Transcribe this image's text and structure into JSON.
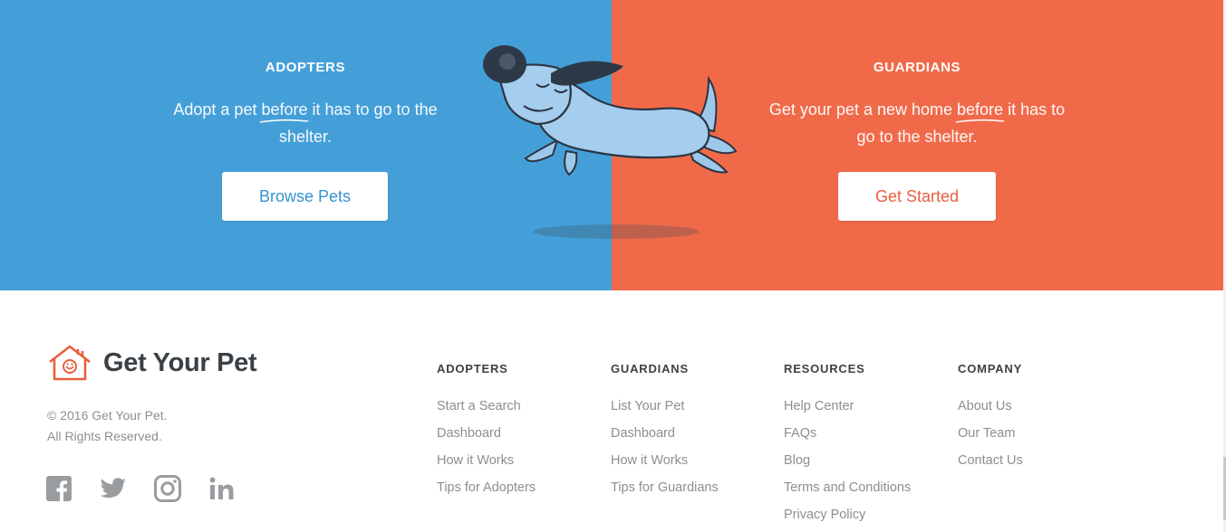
{
  "hero": {
    "adopters": {
      "heading": "ADOPTERS",
      "text_before": "Adopt a pet ",
      "text_emphasis": "before",
      "text_after": " it has to go to the shelter.",
      "button": "Browse Pets"
    },
    "guardians": {
      "heading": "GUARDIANS",
      "text_before": "Get your pet a new home ",
      "text_emphasis": "before",
      "text_after": " it has to go to the shelter.",
      "button": "Get Started"
    },
    "colors": {
      "blue": "#449fd8",
      "orange": "#f06a4a"
    }
  },
  "footer": {
    "brand": "Get Your Pet",
    "copyright_line1": "© 2016 Get Your Pet.",
    "copyright_line2": "All Rights Reserved.",
    "social": [
      "facebook-icon",
      "twitter-icon",
      "instagram-icon",
      "linkedin-icon"
    ],
    "columns": [
      {
        "title": "ADOPTERS",
        "links": [
          "Start a Search",
          "Dashboard",
          "How it Works",
          "Tips for Adopters"
        ]
      },
      {
        "title": "GUARDIANS",
        "links": [
          "List Your Pet",
          "Dashboard",
          "How it Works",
          "Tips for Guardians"
        ]
      },
      {
        "title": "RESOURCES",
        "links": [
          "Help Center",
          "FAQs",
          "Blog",
          "Terms and Conditions",
          "Privacy Policy"
        ]
      },
      {
        "title": "COMPANY",
        "links": [
          "About Us",
          "Our Team",
          "Contact Us"
        ]
      }
    ]
  }
}
